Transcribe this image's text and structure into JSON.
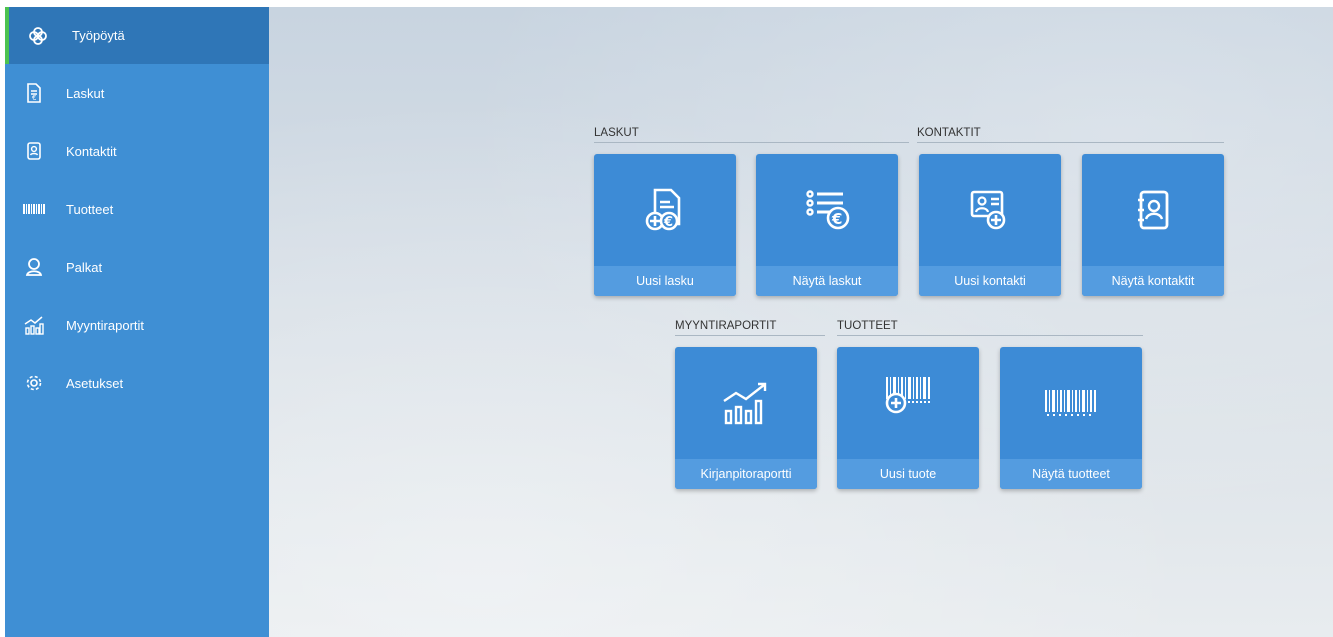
{
  "sidebar": {
    "items": [
      {
        "label": "Työpöytä",
        "icon": "dashboard-icon",
        "active": true
      },
      {
        "label": "Laskut",
        "icon": "invoice-icon"
      },
      {
        "label": "Kontaktit",
        "icon": "contacts-icon"
      },
      {
        "label": "Tuotteet",
        "icon": "barcode-icon"
      },
      {
        "label": "Palkat",
        "icon": "person-icon"
      },
      {
        "label": "Myyntiraportit",
        "icon": "chart-icon"
      },
      {
        "label": "Asetukset",
        "icon": "gear-icon"
      }
    ]
  },
  "sections": {
    "laskut": "LASKUT",
    "kontaktit": "KONTAKTIT",
    "myyntiraportit": "MYYNTIRAPORTIT",
    "tuotteet": "TUOTTEET"
  },
  "tiles": {
    "uusi_lasku": "Uusi lasku",
    "nayta_laskut": "Näytä laskut",
    "uusi_kontakti": "Uusi kontakti",
    "nayta_kontaktit": "Näytä kontaktit",
    "kirjanpitoraportti": "Kirjanpitoraportti",
    "uusi_tuote": "Uusi tuote",
    "nayta_tuotteet": "Näytä tuotteet"
  },
  "colors": {
    "sidebar": "#3f8fd4",
    "sidebar_active": "#2f76b7",
    "active_marker": "#4cc24f",
    "tile": "#3d8bd6",
    "tile_label": "#549ce0"
  }
}
